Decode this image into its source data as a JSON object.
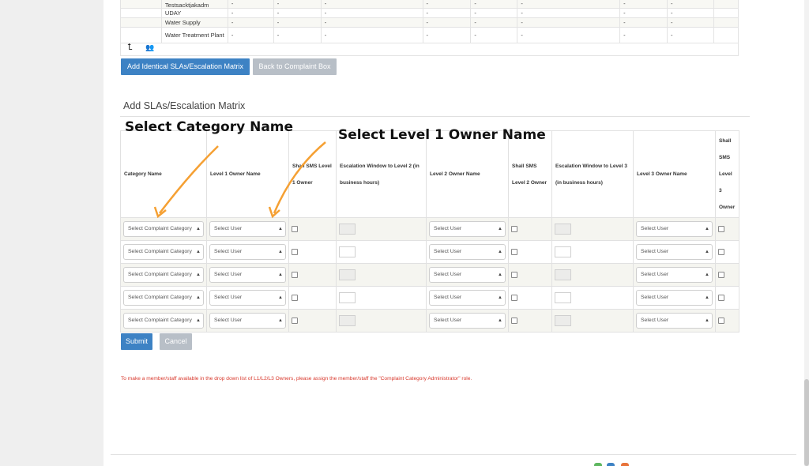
{
  "top_table": {
    "rows": [
      {
        "name": "Testsacktjakadm",
        "cells": [
          "-",
          "-",
          "-",
          "-",
          "-",
          "-",
          "-",
          "-"
        ]
      },
      {
        "name": "UDAY",
        "cells": [
          "-",
          "-",
          "-",
          "-",
          "-",
          "-",
          "-",
          "-"
        ]
      },
      {
        "name": "Water Supply",
        "cells": [
          "-",
          "-",
          "-",
          "-",
          "-",
          "-",
          "-",
          "-"
        ]
      },
      {
        "name": "Water Treatment Plant",
        "cells": [
          "-",
          "-",
          "-",
          "-",
          "-",
          "-",
          "-",
          "-"
        ]
      }
    ]
  },
  "buttons": {
    "add_identical": "Add Identical SLAs/Escalation Matrix",
    "back": "Back to Complaint Box",
    "submit": "Submit",
    "cancel": "Cancel"
  },
  "section_title": "Add SLAs/Escalation Matrix",
  "matrix": {
    "headers": {
      "category": "Category Name",
      "l1_owner": "Level 1 Owner Name",
      "sms_l1": "Shall SMS Level 1 Owner",
      "escalation_l2": "Escalation Window to Level 2 (in business hours)",
      "l2_owner": "Level 2 Owner Name",
      "sms_l2": "Shall SMS Level 2 Owner",
      "escalation_l3": "Escalation Window to Level 3 (in business hours)",
      "l3_owner": "Level 3 Owner Name",
      "sms_l3": "Shall SMS Level 3 Owner"
    },
    "category_placeholder": "Select Complaint Category",
    "user_placeholder": "Select User",
    "row_count": 5
  },
  "note": "To make a member/staff available in the drop down list of L1/L2/L3 Owners, please assign the member/staff the \"Complaint Category Administrator\" role.",
  "annotations": {
    "category": "Select Category Name",
    "level1": "Select Level 1 Owner Name",
    "arrow_color": "#f5a033"
  },
  "colors": {
    "primary": "#3d82c4",
    "secondary": "#b8bfc7",
    "note": "#d8382c"
  },
  "icons": [
    "return-arrow-icon",
    "people-icon",
    "select-arrow-icon"
  ]
}
